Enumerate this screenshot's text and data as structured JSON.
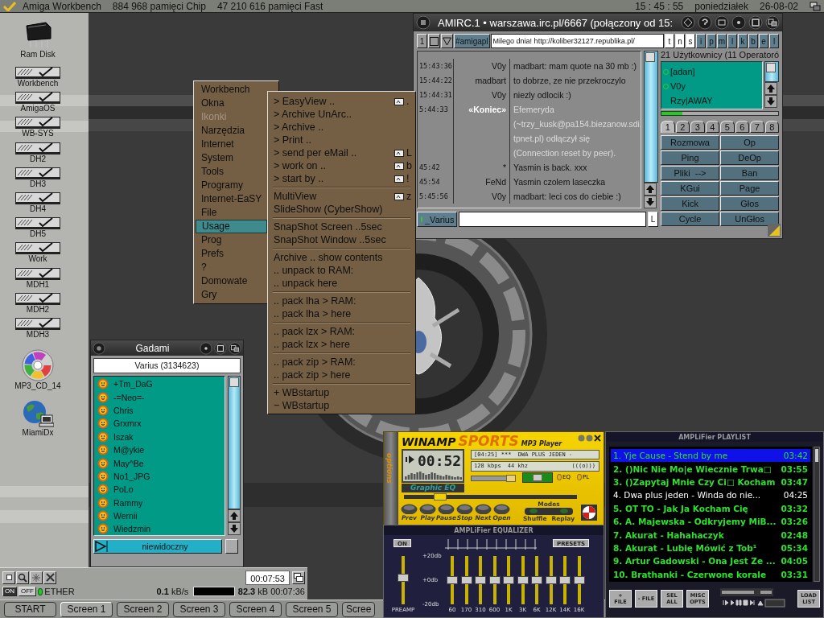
{
  "screen_bar": {
    "title": "Amiga Workbench",
    "chip": "884 968 pamięci Chip",
    "fast": "47 210 616 pamięci Fast",
    "time": "15 : 45 : 55",
    "day": "poniedziałek",
    "date": "26-08-02"
  },
  "desktop_icons": [
    {
      "label": "Ram Disk",
      "kind": "chip"
    },
    {
      "label": "Workbench",
      "kind": "drive"
    },
    {
      "label": "AmigaOS",
      "kind": "drive"
    },
    {
      "label": "WB-SYS",
      "kind": "drive"
    },
    {
      "label": "DH2",
      "kind": "drive"
    },
    {
      "label": "DH3",
      "kind": "drive"
    },
    {
      "label": "DH4",
      "kind": "drive"
    },
    {
      "label": "DH5",
      "kind": "drive"
    },
    {
      "label": "Work",
      "kind": "drive"
    },
    {
      "label": "MDH1",
      "kind": "drive"
    },
    {
      "label": "MDH2",
      "kind": "drive"
    },
    {
      "label": "MDH3",
      "kind": "drive"
    },
    {
      "label": "MP3_CD_14",
      "kind": "cd"
    },
    {
      "label": "MiamiDx",
      "kind": "network"
    }
  ],
  "menu": {
    "items": [
      {
        "label": "Workbench",
        "selected": false,
        "disabled": false
      },
      {
        "label": "Okna",
        "selected": false,
        "disabled": false
      },
      {
        "label": "Ikonki",
        "selected": false,
        "disabled": true
      },
      {
        "label": "Narzędzia",
        "selected": false,
        "disabled": false
      },
      {
        "label": "Internet",
        "selected": false,
        "disabled": false
      },
      {
        "label": "System",
        "selected": false,
        "disabled": false
      },
      {
        "label": "Tools",
        "selected": false,
        "disabled": false
      },
      {
        "label": "Programy",
        "selected": false,
        "disabled": false
      },
      {
        "label": "Internet-EaSY",
        "selected": false,
        "disabled": false
      },
      {
        "label": "File",
        "selected": false,
        "disabled": false
      },
      {
        "label": "Usage",
        "selected": true,
        "disabled": false
      },
      {
        "label": "Prog",
        "selected": false,
        "disabled": false
      },
      {
        "label": "Prefs",
        "selected": false,
        "disabled": false
      },
      {
        "label": "?",
        "selected": false,
        "disabled": false
      },
      {
        "label": "Domowate",
        "selected": false,
        "disabled": false
      },
      {
        "label": "Gry",
        "selected": false,
        "disabled": false
      }
    ],
    "submenu": [
      [
        {
          "label": "> EasyView ..",
          "shortcut": "."
        },
        {
          "label": "> Archive UnArc.."
        },
        {
          "label": "> Archive .."
        },
        {
          "label": "> Print .."
        },
        {
          "label": "> send per eMail ..",
          "shortcut": "L"
        },
        {
          "label": "> work on ..",
          "shortcut": "b"
        },
        {
          "label": "> start by ..",
          "shortcut": "!"
        }
      ],
      [
        {
          "label": "MultiView",
          "shortcut": "z"
        },
        {
          "label": "SlideShow (CyberShow)"
        }
      ],
      [
        {
          "label": "SnapShot Screen ..5sec"
        },
        {
          "label": "SnapShot Window ..5sec"
        }
      ],
      [
        {
          "label": "Archive .. show contents"
        },
        {
          "label": ".. unpack to RAM:"
        },
        {
          "label": ".. unpack here"
        }
      ],
      [
        {
          "label": ".. pack lha > RAM:"
        },
        {
          "label": ".. pack lha > here"
        }
      ],
      [
        {
          "label": ".. pack lzx > RAM:"
        },
        {
          "label": ".. pack lzx > here"
        }
      ],
      [
        {
          "label": ".. pack zip > RAM:"
        },
        {
          "label": ".. pack zip > here"
        }
      ],
      [
        {
          "label": "+ WBstartup"
        },
        {
          "label": "− WBstartup"
        }
      ]
    ]
  },
  "irc": {
    "title": "AMIRC.1 • warszawa.irc.pl/6667 (połączony od 15:",
    "channel_number": "1",
    "channel": "#amigapl",
    "topic": "Milego dnia!  http://koliber32127.republika.pl/",
    "modes": [
      {
        "label": "t",
        "on": true
      },
      {
        "label": "n",
        "on": true
      },
      {
        "label": "s",
        "on": true
      },
      {
        "label": "i",
        "on": false
      },
      {
        "label": "p",
        "on": false
      },
      {
        "label": "m",
        "on": false
      },
      {
        "label": "l",
        "on": false
      },
      {
        "label": "k",
        "on": false
      },
      {
        "label": "b",
        "on": false
      },
      {
        "label": "e",
        "on": false
      },
      {
        "label": "l",
        "on": false
      }
    ],
    "lines": [
      {
        "time": "15:43:36",
        "nick": "V0y",
        "text": "madbart: mam quote na 30 mb :)",
        "kind": "message"
      },
      {
        "time": "15:44:22",
        "nick": "madbart",
        "text": "to dobrze, ze nie przekroczylo",
        "kind": "message"
      },
      {
        "time": "15:44:31",
        "nick": "V0y",
        "text": "niezly odlocik :)",
        "kind": "message"
      },
      {
        "time": "5:44:33",
        "nick": "«Koniec»",
        "text": "Efemeryda",
        "kind": "notice"
      },
      {
        "text": "(~trzy_kusk@pa154.biezanow.sdi.",
        "kind": "notice"
      },
      {
        "text": "tpnet.pl) odłączył się",
        "kind": "notice"
      },
      {
        "text": "(Connection reset by peer).",
        "kind": "notice"
      },
      {
        "time": "45:42",
        "nick": "*",
        "text": "Yasmin is back. xxx",
        "kind": "message"
      },
      {
        "time": "45:54",
        "nick": "FeNd",
        "text": "Yasmin czolem laseczka",
        "kind": "message"
      },
      {
        "time": "5:45:56",
        "nick": "V0y",
        "text": "madbart: leci cos do ciebie :)",
        "kind": "message"
      }
    ],
    "users_header": "21 Użytkownicy (11 Operatoró",
    "users": [
      {
        "name": "[adan]",
        "op": true
      },
      {
        "name": "V0y",
        "op": true
      },
      {
        "name": "Rzy|AWAY",
        "op": false
      }
    ],
    "lag_meter": {
      "level": 0.18
    },
    "tabs": [
      {
        "label": "1",
        "selected": true
      },
      {
        "label": "2",
        "selected": false
      },
      {
        "label": "3",
        "selected": false
      },
      {
        "label": "4",
        "selected": false
      },
      {
        "label": "5",
        "selected": false
      },
      {
        "label": "6",
        "selected": false
      },
      {
        "label": "7",
        "selected": false
      },
      {
        "label": "8",
        "selected": false
      }
    ],
    "buttons": [
      "Rozmowa",
      "Op",
      "Ping",
      "DeOp",
      "Pliki  -->",
      "Ban",
      "KGui",
      "Page",
      "Kick",
      "Głos",
      "Cycle",
      "UnGłos"
    ],
    "nick": "_Varius",
    "input_button": "L"
  },
  "gadami": {
    "title": "Gadami",
    "user": "Varius (3134623)",
    "contacts": [
      "+Tm_DaG",
      "-=Neo=-",
      "Chris",
      "Grxmrx",
      "Iszak",
      "M@ykie",
      "May^Be",
      "No1_JPG",
      "PoLo",
      "Rammy",
      "Wernii",
      "Wiedzmin"
    ],
    "status": "niewidoczny"
  },
  "winamp": {
    "brand": "WINAMP",
    "edition": "SPORTS",
    "subtitle": "MP3 Player",
    "options": "options",
    "time": "00:52",
    "marquee": "[04:25] ***  DWA PLUS JEDEN -",
    "bitrate": "128 kbps",
    "samplerate": "44 khz",
    "stereo": "(((o)))",
    "eq_label": "Graphic EQ",
    "eq_toggle": "EQ",
    "pl_toggle": "PL",
    "volume": {
      "level": 0.9
    },
    "balance": {
      "level": 0.5
    },
    "seek": {
      "level": 0.2
    },
    "buttons": [
      "Prev",
      "Play",
      "Pause",
      "Stop",
      "Next",
      "Open"
    ],
    "modes": "Modes",
    "mode_toggles": [
      {
        "label": "Shuffle",
        "on": false
      },
      {
        "label": "Replay",
        "on": false
      }
    ]
  },
  "equalizer": {
    "title": "AMPLiFier EQUALIZER",
    "on": "ON",
    "presets": "PRESETS",
    "scale": [
      "+20db",
      "+0db",
      "-20db"
    ],
    "preamp": {
      "label": "PREAMP",
      "level": 0.55
    },
    "bands": [
      {
        "label": "60",
        "level": 0.5
      },
      {
        "label": "170",
        "level": 0.5
      },
      {
        "label": "310",
        "level": 0.5
      },
      {
        "label": "600",
        "level": 0.5
      },
      {
        "label": "1K",
        "level": 0.5
      },
      {
        "label": "3K",
        "level": 0.5
      },
      {
        "label": "6K",
        "level": 0.5
      },
      {
        "label": "12K",
        "level": 0.5
      },
      {
        "label": "14K",
        "level": 0.5
      },
      {
        "label": "16K",
        "level": 0.5
      }
    ]
  },
  "playlist": {
    "title": "AMPLiFier PLAYLIST",
    "tracks": [
      {
        "title": "1. Yje Cause - Stend by me",
        "length": "03:42",
        "selected": true,
        "playing": false
      },
      {
        "title": "2. ()Nic Nie Mo|e Wiecznie Trwa□",
        "length": "03:55",
        "selected": false,
        "playing": false
      },
      {
        "title": "3. ()Zapytaj Mnie Czy Ci□ Kocham",
        "length": "03:47",
        "selected": false,
        "playing": false
      },
      {
        "title": "4. Dwa plus jeden - Winda do nie...",
        "length": "04:25",
        "selected": false,
        "playing": true
      },
      {
        "title": "5. OT TO - Jak Ja Kocham Cię",
        "length": "03:32",
        "selected": false,
        "playing": false
      },
      {
        "title": "6. A. Majewska - Odkryjemy MiB...",
        "length": "03:26",
        "selected": false,
        "playing": false
      },
      {
        "title": "7. Akurat - Hahahaczyk",
        "length": "02:48",
        "selected": false,
        "playing": false
      },
      {
        "title": "8. Akurat - Lubię Mówić z Tob¹",
        "length": "05:34",
        "selected": false,
        "playing": false
      },
      {
        "title": "9. Artur Gadowski - Ona Jest Ze ...",
        "length": "04:05",
        "selected": false,
        "playing": false
      },
      {
        "title": "10. Brathanki - Czerwone korale",
        "length": "03:31",
        "selected": false,
        "playing": false
      }
    ],
    "buttons": [
      "+ FILE",
      "- FILE",
      "SEL ALL",
      "MISC OPTS"
    ],
    "load_button": "LOAD LIST"
  },
  "dock": {
    "timer": "00:07:53",
    "power": [
      {
        "label": "ON",
        "selected": true
      },
      {
        "label": "OFF",
        "selected": false
      }
    ],
    "connection": "ETHER",
    "rate": "**0.1** kB/s",
    "meter": {
      "level": 0
    },
    "transfer": "**82.3** kB 00:07:36"
  },
  "taskbar": [
    {
      "label": "START",
      "selected": false
    },
    {
      "label": "Screen 1",
      "selected": true
    },
    {
      "label": "Screen 2",
      "selected": false
    },
    {
      "label": "Screen 3",
      "selected": false
    },
    {
      "label": "Screen 4",
      "selected": false
    },
    {
      "label": "Screen 5",
      "selected": false
    },
    {
      "label": "Scree",
      "selected": false
    }
  ]
}
